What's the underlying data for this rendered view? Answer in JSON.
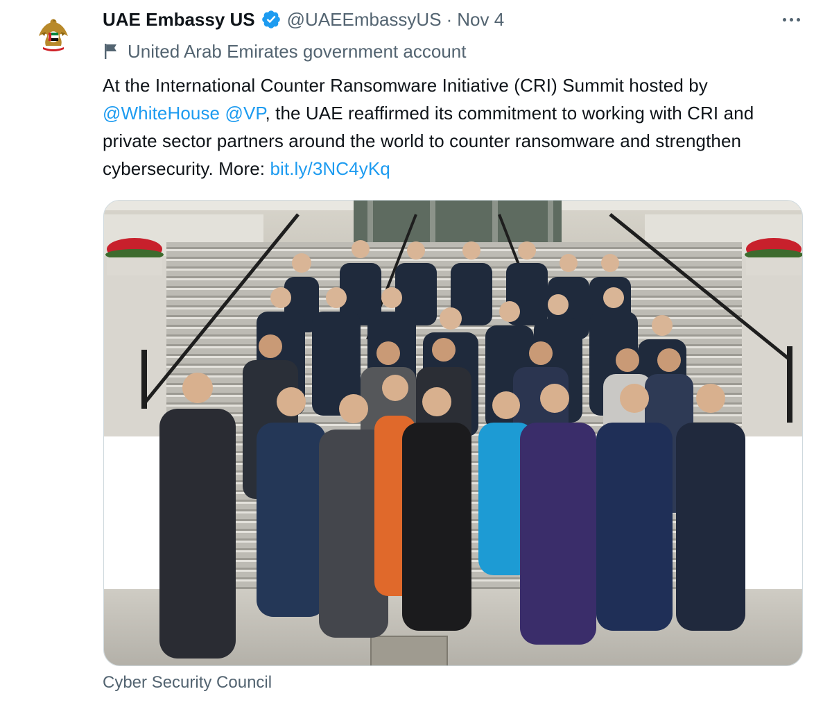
{
  "tweet": {
    "author_name": "UAE Embassy US",
    "handle": "@UAEEmbassyUS",
    "separator": "·",
    "date": "Nov 4",
    "account_label": "United Arab Emirates government account",
    "text": {
      "part1": "At the International Counter Ransomware Initiative (CRI) Summit hosted by ",
      "mention1": "@WhiteHouse",
      "mention2": "@VP",
      "part2": ", the UAE reaffirmed its commitment to working with CRI and private sector partners around the world to counter ransomware and strengthen cybersecurity. More: ",
      "link": "bit.ly/3NC4yKq"
    },
    "media_caption": "Cyber Security Council"
  },
  "icons": {
    "verified": "verified-badge-icon",
    "label": "flag-icon",
    "more": "more-dots-icon"
  },
  "colors": {
    "link": "#1d9bf0",
    "secondary_text": "#536471",
    "primary_text": "#0f1419",
    "verified": "#1d9bf0"
  }
}
